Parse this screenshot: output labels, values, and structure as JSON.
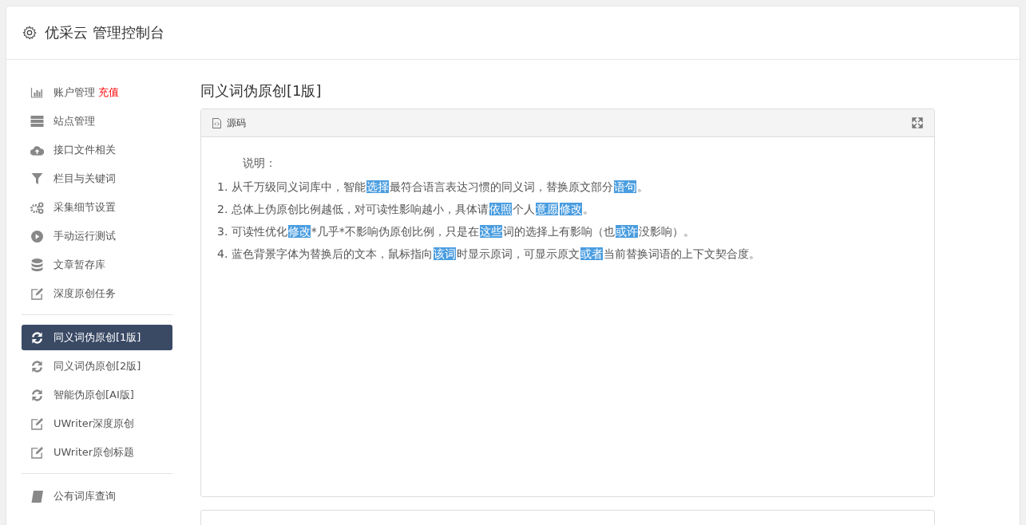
{
  "header": {
    "title": "优采云 管理控制台"
  },
  "sidebar": {
    "groups": [
      {
        "items": [
          {
            "kind": "chart",
            "label": "账户管理",
            "badge": "充值",
            "selected": false
          },
          {
            "kind": "server",
            "label": "站点管理",
            "selected": false
          },
          {
            "kind": "cloud",
            "label": "接口文件相关",
            "selected": false
          },
          {
            "kind": "filter",
            "label": "栏目与关键词",
            "selected": false
          },
          {
            "kind": "gears",
            "label": "采集细节设置",
            "selected": false
          },
          {
            "kind": "play",
            "label": "手动运行测试",
            "selected": false
          },
          {
            "kind": "database",
            "label": "文章暂存库",
            "selected": false
          },
          {
            "kind": "edit",
            "label": "深度原创任务",
            "selected": false
          }
        ]
      },
      {
        "items": [
          {
            "kind": "refresh",
            "label": "同义词伪原创[1版]",
            "selected": true
          },
          {
            "kind": "refresh",
            "label": "同义词伪原创[2版]",
            "selected": false
          },
          {
            "kind": "refresh",
            "label": "智能伪原创[AI版]",
            "selected": false
          },
          {
            "kind": "edit",
            "label": "UWriter深度原创",
            "selected": false
          },
          {
            "kind": "edit",
            "label": "UWriter原创标题",
            "selected": false
          }
        ]
      },
      {
        "items": [
          {
            "kind": "book",
            "label": "公有词库查询",
            "selected": false
          }
        ]
      }
    ]
  },
  "main": {
    "title": "同义词伪原创[1版]",
    "panel": {
      "tab": "源码",
      "heading": "说明：",
      "lines": [
        [
          {
            "text": "1. 从千万级同义词库中，智能",
            "highlighted": false
          },
          {
            "text": "选择",
            "highlighted": true
          },
          {
            "text": "最符合语言表达习惯的同义词，替换原文部分",
            "highlighted": false
          },
          {
            "text": "语句",
            "highlighted": true
          },
          {
            "text": "。",
            "highlighted": false
          }
        ],
        [
          {
            "text": "2. 总体上伪原创比例越低，对可读性影响越小，具体请",
            "highlighted": false
          },
          {
            "text": "依照",
            "highlighted": true
          },
          {
            "text": "个人",
            "highlighted": false
          },
          {
            "text": "意愿",
            "highlighted": true
          },
          {
            "text": "修改",
            "highlighted": true
          },
          {
            "text": "。",
            "highlighted": false
          }
        ],
        [
          {
            "text": "3. 可读性优化",
            "highlighted": false
          },
          {
            "text": "修改",
            "highlighted": true
          },
          {
            "text": "*几乎*不影响伪原创比例，只是在",
            "highlighted": false
          },
          {
            "text": "这些",
            "highlighted": true
          },
          {
            "text": "词的选择上有影响（也",
            "highlighted": false
          },
          {
            "text": "或许",
            "highlighted": true
          },
          {
            "text": "没影响）。",
            "highlighted": false
          }
        ],
        [
          {
            "text": "4. 蓝色背景字体为替换后的文本，鼠标指向",
            "highlighted": false
          },
          {
            "text": "该词",
            "highlighted": true
          },
          {
            "text": "时显示原词，可显示原文",
            "highlighted": false
          },
          {
            "text": "或者",
            "highlighted": true
          },
          {
            "text": "当前替换词语的上下文契合度。",
            "highlighted": false
          }
        ]
      ]
    }
  }
}
